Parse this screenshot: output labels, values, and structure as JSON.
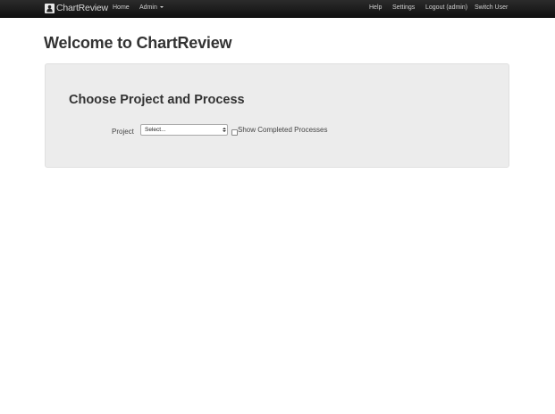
{
  "navbar": {
    "brand": "ChartReview",
    "left_links": [
      {
        "label": "Home"
      },
      {
        "label": "Admin"
      }
    ],
    "right_links": [
      {
        "label": "Help"
      },
      {
        "label": "Settings"
      },
      {
        "label": "Logout (admin)"
      },
      {
        "label": "Switch User"
      }
    ]
  },
  "page": {
    "title": "Welcome to ChartReview"
  },
  "panel": {
    "title": "Choose Project and Process",
    "project_label": "Project",
    "project_select_value": "Select...",
    "show_completed_label": "Show Completed Processes",
    "show_completed_checked": false
  },
  "colors": {
    "navbar_bg": "#1b1b1b",
    "panel_bg": "#ececec"
  },
  "icons": {
    "brand_logo": "person-icon"
  }
}
